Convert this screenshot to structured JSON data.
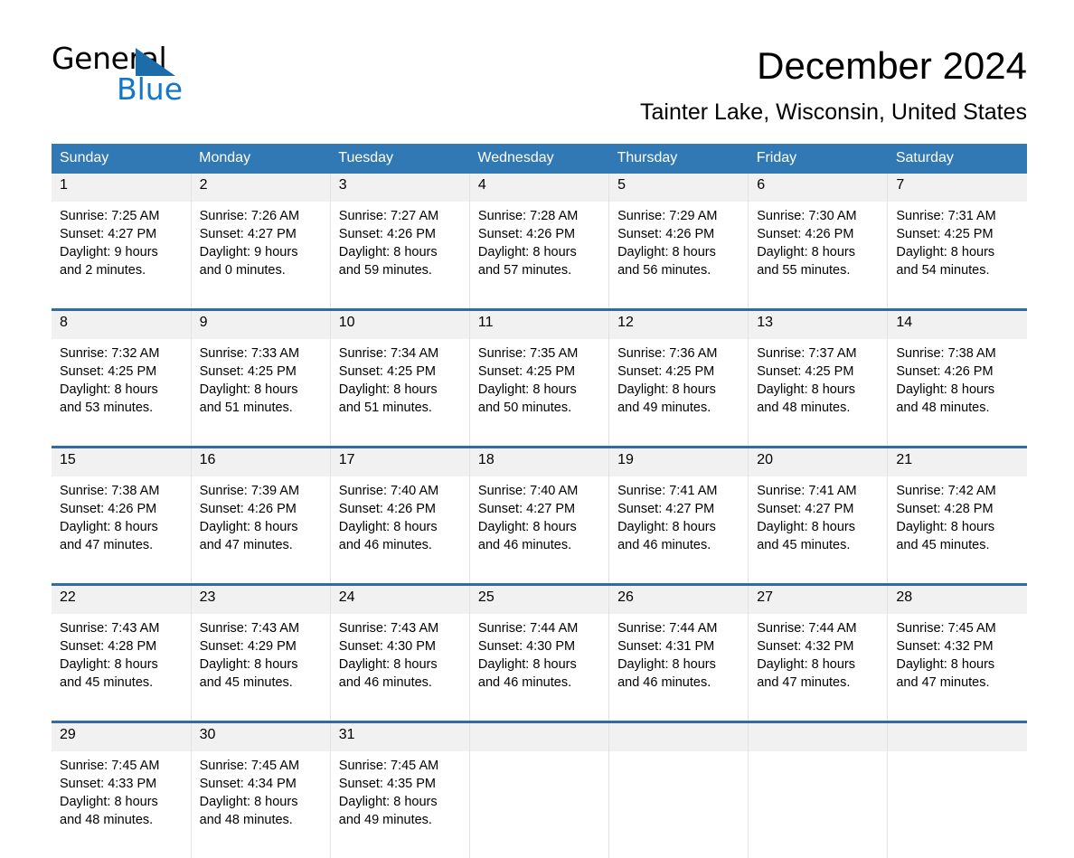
{
  "brand": {
    "name_part1": "General",
    "name_part2": "Blue",
    "logo_icon": "triangle-logo-icon",
    "accent_color": "#1476c4"
  },
  "header": {
    "month_title": "December 2024",
    "location": "Tainter Lake, Wisconsin, United States",
    "header_bg_color": "#3179b4",
    "row_divider_color": "#2e6da4",
    "daynum_band_color": "#f1f1f1"
  },
  "calendar": {
    "weekday_headers": [
      "Sunday",
      "Monday",
      "Tuesday",
      "Wednesday",
      "Thursday",
      "Friday",
      "Saturday"
    ],
    "weeks": [
      [
        {
          "day": "1",
          "sunrise": "Sunrise: 7:25 AM",
          "sunset": "Sunset: 4:27 PM",
          "daylight_line1": "Daylight: 9 hours",
          "daylight_line2": "and 2 minutes."
        },
        {
          "day": "2",
          "sunrise": "Sunrise: 7:26 AM",
          "sunset": "Sunset: 4:27 PM",
          "daylight_line1": "Daylight: 9 hours",
          "daylight_line2": "and 0 minutes."
        },
        {
          "day": "3",
          "sunrise": "Sunrise: 7:27 AM",
          "sunset": "Sunset: 4:26 PM",
          "daylight_line1": "Daylight: 8 hours",
          "daylight_line2": "and 59 minutes."
        },
        {
          "day": "4",
          "sunrise": "Sunrise: 7:28 AM",
          "sunset": "Sunset: 4:26 PM",
          "daylight_line1": "Daylight: 8 hours",
          "daylight_line2": "and 57 minutes."
        },
        {
          "day": "5",
          "sunrise": "Sunrise: 7:29 AM",
          "sunset": "Sunset: 4:26 PM",
          "daylight_line1": "Daylight: 8 hours",
          "daylight_line2": "and 56 minutes."
        },
        {
          "day": "6",
          "sunrise": "Sunrise: 7:30 AM",
          "sunset": "Sunset: 4:26 PM",
          "daylight_line1": "Daylight: 8 hours",
          "daylight_line2": "and 55 minutes."
        },
        {
          "day": "7",
          "sunrise": "Sunrise: 7:31 AM",
          "sunset": "Sunset: 4:25 PM",
          "daylight_line1": "Daylight: 8 hours",
          "daylight_line2": "and 54 minutes."
        }
      ],
      [
        {
          "day": "8",
          "sunrise": "Sunrise: 7:32 AM",
          "sunset": "Sunset: 4:25 PM",
          "daylight_line1": "Daylight: 8 hours",
          "daylight_line2": "and 53 minutes."
        },
        {
          "day": "9",
          "sunrise": "Sunrise: 7:33 AM",
          "sunset": "Sunset: 4:25 PM",
          "daylight_line1": "Daylight: 8 hours",
          "daylight_line2": "and 51 minutes."
        },
        {
          "day": "10",
          "sunrise": "Sunrise: 7:34 AM",
          "sunset": "Sunset: 4:25 PM",
          "daylight_line1": "Daylight: 8 hours",
          "daylight_line2": "and 51 minutes."
        },
        {
          "day": "11",
          "sunrise": "Sunrise: 7:35 AM",
          "sunset": "Sunset: 4:25 PM",
          "daylight_line1": "Daylight: 8 hours",
          "daylight_line2": "and 50 minutes."
        },
        {
          "day": "12",
          "sunrise": "Sunrise: 7:36 AM",
          "sunset": "Sunset: 4:25 PM",
          "daylight_line1": "Daylight: 8 hours",
          "daylight_line2": "and 49 minutes."
        },
        {
          "day": "13",
          "sunrise": "Sunrise: 7:37 AM",
          "sunset": "Sunset: 4:25 PM",
          "daylight_line1": "Daylight: 8 hours",
          "daylight_line2": "and 48 minutes."
        },
        {
          "day": "14",
          "sunrise": "Sunrise: 7:38 AM",
          "sunset": "Sunset: 4:26 PM",
          "daylight_line1": "Daylight: 8 hours",
          "daylight_line2": "and 48 minutes."
        }
      ],
      [
        {
          "day": "15",
          "sunrise": "Sunrise: 7:38 AM",
          "sunset": "Sunset: 4:26 PM",
          "daylight_line1": "Daylight: 8 hours",
          "daylight_line2": "and 47 minutes."
        },
        {
          "day": "16",
          "sunrise": "Sunrise: 7:39 AM",
          "sunset": "Sunset: 4:26 PM",
          "daylight_line1": "Daylight: 8 hours",
          "daylight_line2": "and 47 minutes."
        },
        {
          "day": "17",
          "sunrise": "Sunrise: 7:40 AM",
          "sunset": "Sunset: 4:26 PM",
          "daylight_line1": "Daylight: 8 hours",
          "daylight_line2": "and 46 minutes."
        },
        {
          "day": "18",
          "sunrise": "Sunrise: 7:40 AM",
          "sunset": "Sunset: 4:27 PM",
          "daylight_line1": "Daylight: 8 hours",
          "daylight_line2": "and 46 minutes."
        },
        {
          "day": "19",
          "sunrise": "Sunrise: 7:41 AM",
          "sunset": "Sunset: 4:27 PM",
          "daylight_line1": "Daylight: 8 hours",
          "daylight_line2": "and 46 minutes."
        },
        {
          "day": "20",
          "sunrise": "Sunrise: 7:41 AM",
          "sunset": "Sunset: 4:27 PM",
          "daylight_line1": "Daylight: 8 hours",
          "daylight_line2": "and 45 minutes."
        },
        {
          "day": "21",
          "sunrise": "Sunrise: 7:42 AM",
          "sunset": "Sunset: 4:28 PM",
          "daylight_line1": "Daylight: 8 hours",
          "daylight_line2": "and 45 minutes."
        }
      ],
      [
        {
          "day": "22",
          "sunrise": "Sunrise: 7:43 AM",
          "sunset": "Sunset: 4:28 PM",
          "daylight_line1": "Daylight: 8 hours",
          "daylight_line2": "and 45 minutes."
        },
        {
          "day": "23",
          "sunrise": "Sunrise: 7:43 AM",
          "sunset": "Sunset: 4:29 PM",
          "daylight_line1": "Daylight: 8 hours",
          "daylight_line2": "and 45 minutes."
        },
        {
          "day": "24",
          "sunrise": "Sunrise: 7:43 AM",
          "sunset": "Sunset: 4:30 PM",
          "daylight_line1": "Daylight: 8 hours",
          "daylight_line2": "and 46 minutes."
        },
        {
          "day": "25",
          "sunrise": "Sunrise: 7:44 AM",
          "sunset": "Sunset: 4:30 PM",
          "daylight_line1": "Daylight: 8 hours",
          "daylight_line2": "and 46 minutes."
        },
        {
          "day": "26",
          "sunrise": "Sunrise: 7:44 AM",
          "sunset": "Sunset: 4:31 PM",
          "daylight_line1": "Daylight: 8 hours",
          "daylight_line2": "and 46 minutes."
        },
        {
          "day": "27",
          "sunrise": "Sunrise: 7:44 AM",
          "sunset": "Sunset: 4:32 PM",
          "daylight_line1": "Daylight: 8 hours",
          "daylight_line2": "and 47 minutes."
        },
        {
          "day": "28",
          "sunrise": "Sunrise: 7:45 AM",
          "sunset": "Sunset: 4:32 PM",
          "daylight_line1": "Daylight: 8 hours",
          "daylight_line2": "and 47 minutes."
        }
      ],
      [
        {
          "day": "29",
          "sunrise": "Sunrise: 7:45 AM",
          "sunset": "Sunset: 4:33 PM",
          "daylight_line1": "Daylight: 8 hours",
          "daylight_line2": "and 48 minutes."
        },
        {
          "day": "30",
          "sunrise": "Sunrise: 7:45 AM",
          "sunset": "Sunset: 4:34 PM",
          "daylight_line1": "Daylight: 8 hours",
          "daylight_line2": "and 48 minutes."
        },
        {
          "day": "31",
          "sunrise": "Sunrise: 7:45 AM",
          "sunset": "Sunset: 4:35 PM",
          "daylight_line1": "Daylight: 8 hours",
          "daylight_line2": "and 49 minutes."
        },
        null,
        null,
        null,
        null
      ]
    ]
  }
}
